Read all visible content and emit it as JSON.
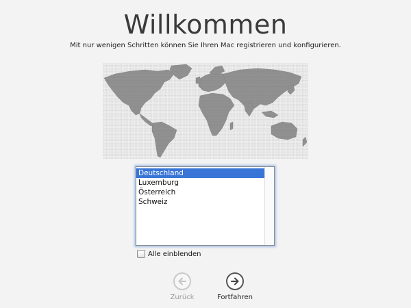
{
  "header": {
    "title": "Willkommen",
    "subtitle": "Mit nur wenigen Schritten können Sie Ihren Mac registrieren und konfigurieren."
  },
  "map": {
    "icon": "world-map-icon"
  },
  "country_list": {
    "items": [
      "Deutschland",
      "Luxemburg",
      "Österreich",
      "Schweiz"
    ],
    "selected": "Deutschland"
  },
  "show_all": {
    "label": "Alle einblenden",
    "checked": false
  },
  "navigation": {
    "back_label": "Zurück",
    "back_enabled": false,
    "continue_label": "Fortfahren"
  },
  "colors": {
    "background": "#f3f3f3",
    "selection": "#3875d7",
    "map_fill": "#8a8a8a",
    "focus_ring": "#a9c6ee"
  }
}
